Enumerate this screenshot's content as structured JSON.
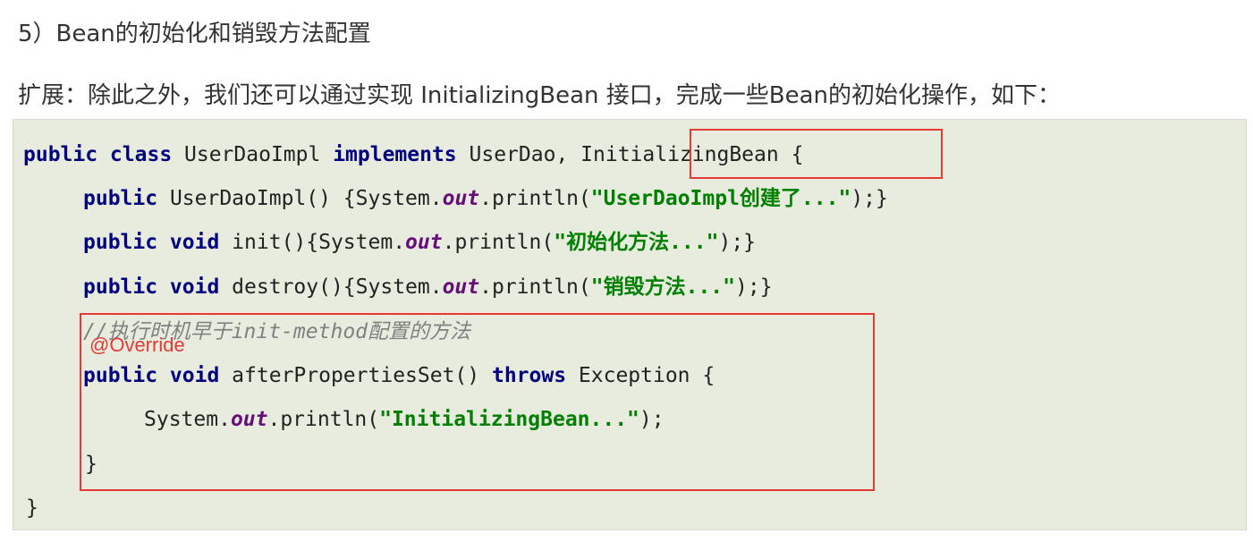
{
  "heading": "5）Bean的初始化和销毁方法配置",
  "intro": "扩展：除此之外，我们还可以通过实现 InitializingBean 接口，完成一些Bean的初始化操作，如下：",
  "code": {
    "line1": {
      "kw1": "public class",
      "text1": " UserDaoImpl ",
      "kw2": "implements",
      "text2": " UserDao, ",
      "iface": "InitializingBean",
      "text3": " {"
    },
    "line2": {
      "kw": "public",
      "text1": " UserDaoImpl() {System.",
      "field": "out",
      "text2": ".println(",
      "str": "\"UserDaoImpl创建了...\"",
      "text3": ");}"
    },
    "line3": {
      "kw": "public void",
      "text1": " init(){System.",
      "field": "out",
      "text2": ".println(",
      "str": "\"初始化方法...\"",
      "text3": ");}"
    },
    "line4": {
      "kw": "public void",
      "text1": " destroy(){System.",
      "field": "out",
      "text2": ".println(",
      "str": "\"销毁方法...\"",
      "text3": ");}"
    },
    "line5": {
      "comment": "//执行时机早于init-method配置的方法"
    },
    "line6": {
      "kw1": "public void",
      "text1": " afterPropertiesSet() ",
      "kw2": "throws",
      "text2": " Exception {"
    },
    "line7": {
      "text1": "System.",
      "field": "out",
      "text2": ".println(",
      "str": "\"InitializingBean...\"",
      "text3": ");"
    },
    "line8": {
      "text": "}"
    },
    "line9": {
      "text": "}"
    }
  },
  "annotation": "@Override",
  "colors": {
    "keyword": "#000080",
    "string": "#008000",
    "static_field": "#660e7a",
    "comment": "#808080",
    "highlight": "#e53935",
    "code_background": "#e8ecde"
  }
}
